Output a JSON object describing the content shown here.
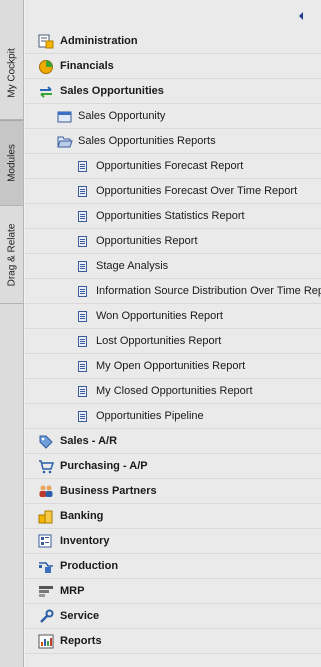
{
  "side_tabs": [
    "My Cockpit",
    "Modules",
    "Drag & Relate"
  ],
  "active_side_tab": "Modules",
  "modules": [
    {
      "label": "Administration",
      "icon": "administration-icon"
    },
    {
      "label": "Financials",
      "icon": "financials-icon"
    },
    {
      "label": "Sales Opportunities",
      "icon": "sales-opportunities-icon",
      "expanded": true
    },
    {
      "label": "Sales - A/R",
      "icon": "sales-ar-icon"
    },
    {
      "label": "Purchasing - A/P",
      "icon": "purchasing-ap-icon"
    },
    {
      "label": "Business Partners",
      "icon": "business-partners-icon"
    },
    {
      "label": "Banking",
      "icon": "banking-icon"
    },
    {
      "label": "Inventory",
      "icon": "inventory-icon"
    },
    {
      "label": "Production",
      "icon": "production-icon"
    },
    {
      "label": "MRP",
      "icon": "mrp-icon"
    },
    {
      "label": "Service",
      "icon": "service-icon"
    },
    {
      "label": "Reports",
      "icon": "reports-icon"
    }
  ],
  "sales_opportunities": {
    "sales_opportunity": "Sales Opportunity",
    "reports_folder": "Sales Opportunities Reports",
    "reports": [
      "Opportunities Forecast Report",
      "Opportunities Forecast Over Time Report",
      "Opportunities Statistics Report",
      "Opportunities Report",
      "Stage Analysis",
      "Information Source Distribution Over Time Report",
      "Won Opportunities Report",
      "Lost Opportunities Report",
      "My Open Opportunities Report",
      "My Closed Opportunities Report",
      "Opportunities Pipeline"
    ]
  }
}
